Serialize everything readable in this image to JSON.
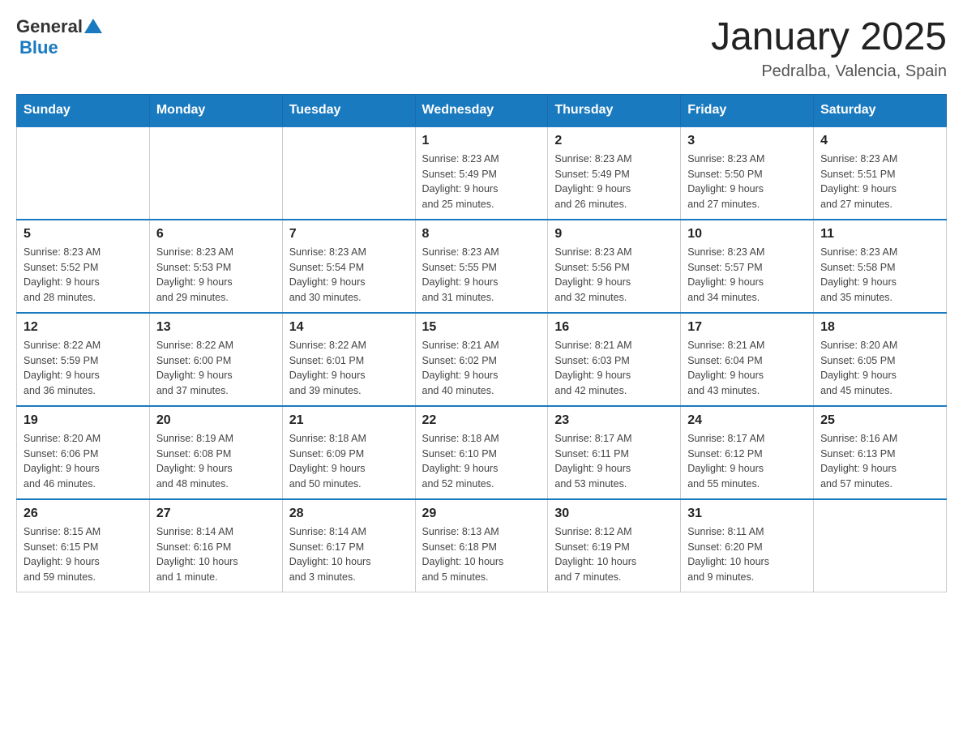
{
  "logo": {
    "general": "General",
    "blue": "Blue"
  },
  "title": "January 2025",
  "subtitle": "Pedralba, Valencia, Spain",
  "days_of_week": [
    "Sunday",
    "Monday",
    "Tuesday",
    "Wednesday",
    "Thursday",
    "Friday",
    "Saturday"
  ],
  "weeks": [
    [
      {
        "day": "",
        "info": ""
      },
      {
        "day": "",
        "info": ""
      },
      {
        "day": "",
        "info": ""
      },
      {
        "day": "1",
        "info": "Sunrise: 8:23 AM\nSunset: 5:49 PM\nDaylight: 9 hours\nand 25 minutes."
      },
      {
        "day": "2",
        "info": "Sunrise: 8:23 AM\nSunset: 5:49 PM\nDaylight: 9 hours\nand 26 minutes."
      },
      {
        "day": "3",
        "info": "Sunrise: 8:23 AM\nSunset: 5:50 PM\nDaylight: 9 hours\nand 27 minutes."
      },
      {
        "day": "4",
        "info": "Sunrise: 8:23 AM\nSunset: 5:51 PM\nDaylight: 9 hours\nand 27 minutes."
      }
    ],
    [
      {
        "day": "5",
        "info": "Sunrise: 8:23 AM\nSunset: 5:52 PM\nDaylight: 9 hours\nand 28 minutes."
      },
      {
        "day": "6",
        "info": "Sunrise: 8:23 AM\nSunset: 5:53 PM\nDaylight: 9 hours\nand 29 minutes."
      },
      {
        "day": "7",
        "info": "Sunrise: 8:23 AM\nSunset: 5:54 PM\nDaylight: 9 hours\nand 30 minutes."
      },
      {
        "day": "8",
        "info": "Sunrise: 8:23 AM\nSunset: 5:55 PM\nDaylight: 9 hours\nand 31 minutes."
      },
      {
        "day": "9",
        "info": "Sunrise: 8:23 AM\nSunset: 5:56 PM\nDaylight: 9 hours\nand 32 minutes."
      },
      {
        "day": "10",
        "info": "Sunrise: 8:23 AM\nSunset: 5:57 PM\nDaylight: 9 hours\nand 34 minutes."
      },
      {
        "day": "11",
        "info": "Sunrise: 8:23 AM\nSunset: 5:58 PM\nDaylight: 9 hours\nand 35 minutes."
      }
    ],
    [
      {
        "day": "12",
        "info": "Sunrise: 8:22 AM\nSunset: 5:59 PM\nDaylight: 9 hours\nand 36 minutes."
      },
      {
        "day": "13",
        "info": "Sunrise: 8:22 AM\nSunset: 6:00 PM\nDaylight: 9 hours\nand 37 minutes."
      },
      {
        "day": "14",
        "info": "Sunrise: 8:22 AM\nSunset: 6:01 PM\nDaylight: 9 hours\nand 39 minutes."
      },
      {
        "day": "15",
        "info": "Sunrise: 8:21 AM\nSunset: 6:02 PM\nDaylight: 9 hours\nand 40 minutes."
      },
      {
        "day": "16",
        "info": "Sunrise: 8:21 AM\nSunset: 6:03 PM\nDaylight: 9 hours\nand 42 minutes."
      },
      {
        "day": "17",
        "info": "Sunrise: 8:21 AM\nSunset: 6:04 PM\nDaylight: 9 hours\nand 43 minutes."
      },
      {
        "day": "18",
        "info": "Sunrise: 8:20 AM\nSunset: 6:05 PM\nDaylight: 9 hours\nand 45 minutes."
      }
    ],
    [
      {
        "day": "19",
        "info": "Sunrise: 8:20 AM\nSunset: 6:06 PM\nDaylight: 9 hours\nand 46 minutes."
      },
      {
        "day": "20",
        "info": "Sunrise: 8:19 AM\nSunset: 6:08 PM\nDaylight: 9 hours\nand 48 minutes."
      },
      {
        "day": "21",
        "info": "Sunrise: 8:18 AM\nSunset: 6:09 PM\nDaylight: 9 hours\nand 50 minutes."
      },
      {
        "day": "22",
        "info": "Sunrise: 8:18 AM\nSunset: 6:10 PM\nDaylight: 9 hours\nand 52 minutes."
      },
      {
        "day": "23",
        "info": "Sunrise: 8:17 AM\nSunset: 6:11 PM\nDaylight: 9 hours\nand 53 minutes."
      },
      {
        "day": "24",
        "info": "Sunrise: 8:17 AM\nSunset: 6:12 PM\nDaylight: 9 hours\nand 55 minutes."
      },
      {
        "day": "25",
        "info": "Sunrise: 8:16 AM\nSunset: 6:13 PM\nDaylight: 9 hours\nand 57 minutes."
      }
    ],
    [
      {
        "day": "26",
        "info": "Sunrise: 8:15 AM\nSunset: 6:15 PM\nDaylight: 9 hours\nand 59 minutes."
      },
      {
        "day": "27",
        "info": "Sunrise: 8:14 AM\nSunset: 6:16 PM\nDaylight: 10 hours\nand 1 minute."
      },
      {
        "day": "28",
        "info": "Sunrise: 8:14 AM\nSunset: 6:17 PM\nDaylight: 10 hours\nand 3 minutes."
      },
      {
        "day": "29",
        "info": "Sunrise: 8:13 AM\nSunset: 6:18 PM\nDaylight: 10 hours\nand 5 minutes."
      },
      {
        "day": "30",
        "info": "Sunrise: 8:12 AM\nSunset: 6:19 PM\nDaylight: 10 hours\nand 7 minutes."
      },
      {
        "day": "31",
        "info": "Sunrise: 8:11 AM\nSunset: 6:20 PM\nDaylight: 10 hours\nand 9 minutes."
      },
      {
        "day": "",
        "info": ""
      }
    ]
  ]
}
